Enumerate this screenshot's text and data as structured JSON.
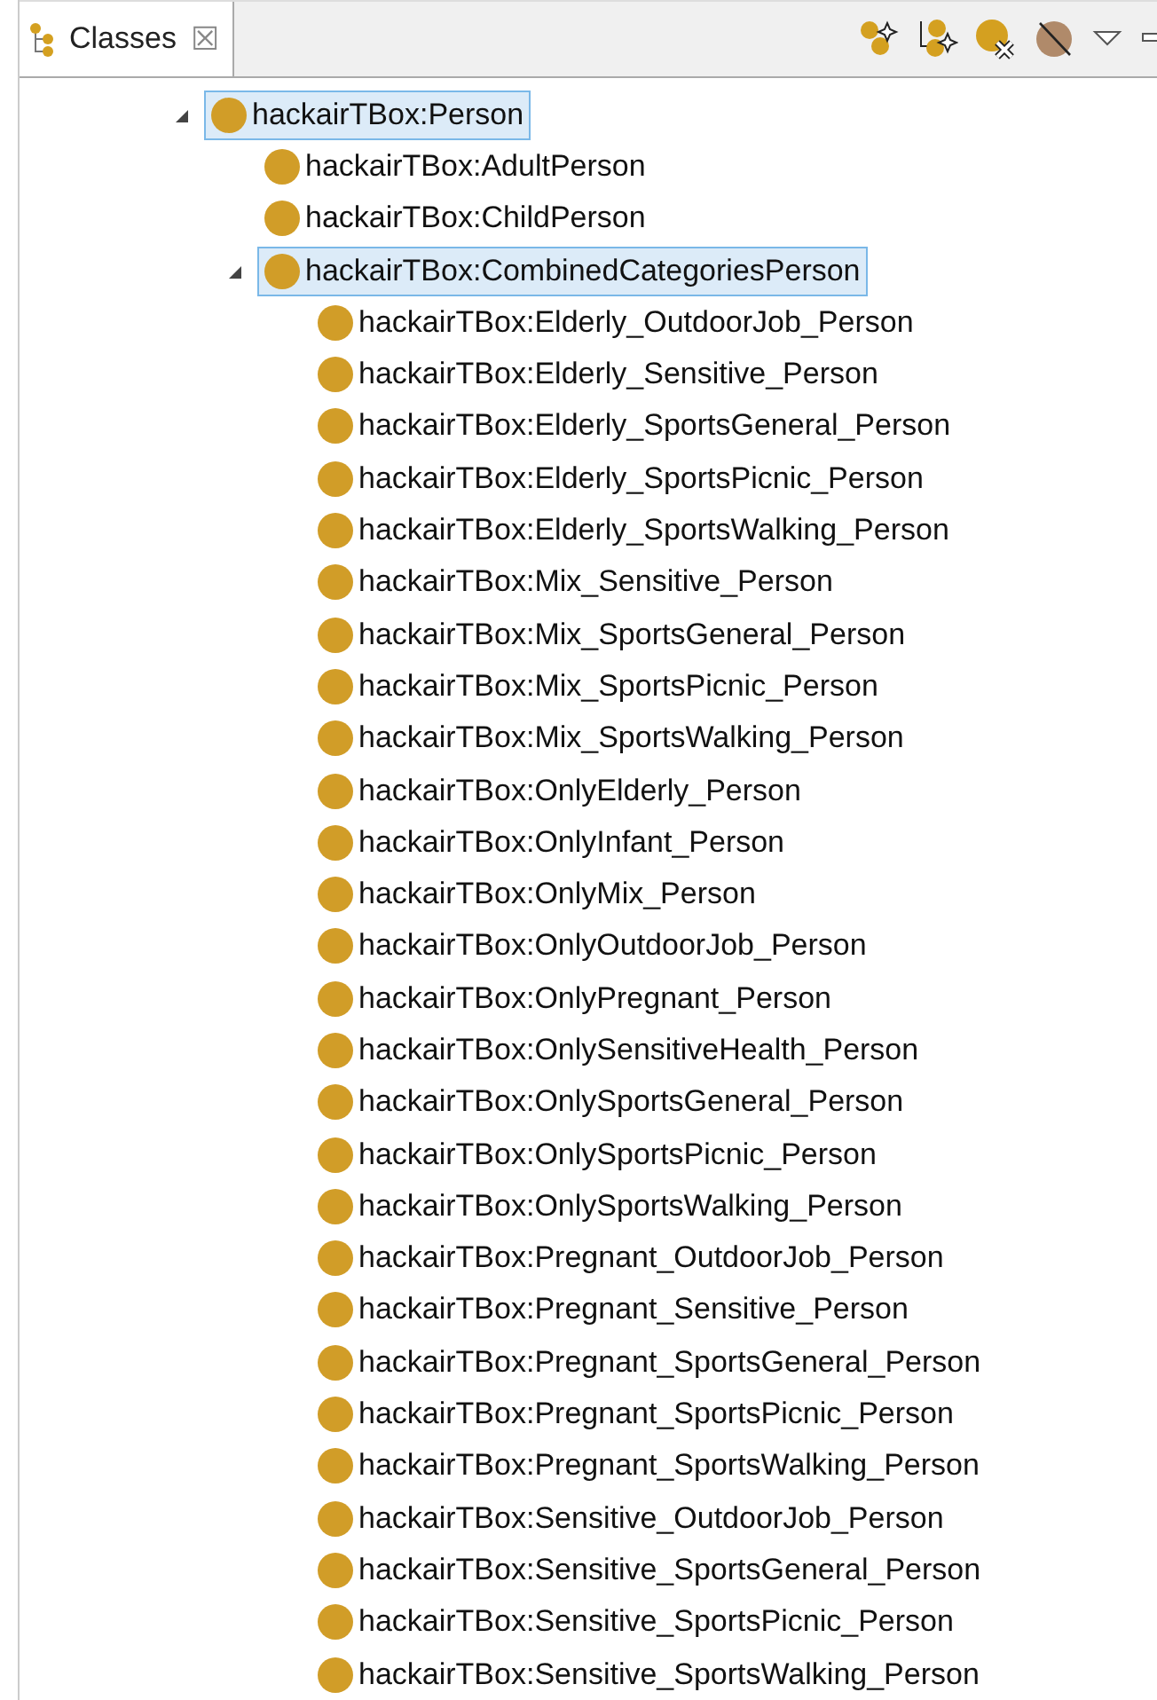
{
  "tab": {
    "title": "Classes",
    "close": "☒"
  },
  "tree": [
    {
      "label": "hackairTBox:Person",
      "expanded": true,
      "selected": true,
      "children": [
        {
          "label": "hackairTBox:AdultPerson",
          "selected": false
        },
        {
          "label": "hackairTBox:ChildPerson",
          "selected": false
        },
        {
          "label": "hackairTBox:CombinedCategoriesPerson",
          "expanded": true,
          "selected": true,
          "children": [
            {
              "label": "hackairTBox:Elderly_OutdoorJob_Person",
              "selected": false
            },
            {
              "label": "hackairTBox:Elderly_Sensitive_Person",
              "selected": false
            },
            {
              "label": "hackairTBox:Elderly_SportsGeneral_Person",
              "selected": false
            },
            {
              "label": "hackairTBox:Elderly_SportsPicnic_Person",
              "selected": false
            },
            {
              "label": "hackairTBox:Elderly_SportsWalking_Person",
              "selected": false
            },
            {
              "label": "hackairTBox:Mix_Sensitive_Person",
              "selected": false
            },
            {
              "label": "hackairTBox:Mix_SportsGeneral_Person",
              "selected": false
            },
            {
              "label": "hackairTBox:Mix_SportsPicnic_Person",
              "selected": false
            },
            {
              "label": "hackairTBox:Mix_SportsWalking_Person",
              "selected": false
            },
            {
              "label": "hackairTBox:OnlyElderly_Person",
              "selected": false
            },
            {
              "label": "hackairTBox:OnlyInfant_Person",
              "selected": false
            },
            {
              "label": "hackairTBox:OnlyMix_Person",
              "selected": false
            },
            {
              "label": "hackairTBox:OnlyOutdoorJob_Person",
              "selected": false
            },
            {
              "label": "hackairTBox:OnlyPregnant_Person",
              "selected": false
            },
            {
              "label": "hackairTBox:OnlySensitiveHealth_Person",
              "selected": false
            },
            {
              "label": "hackairTBox:OnlySportsGeneral_Person",
              "selected": false
            },
            {
              "label": "hackairTBox:OnlySportsPicnic_Person",
              "selected": false
            },
            {
              "label": "hackairTBox:OnlySportsWalking_Person",
              "selected": false
            },
            {
              "label": "hackairTBox:Pregnant_OutdoorJob_Person",
              "selected": false
            },
            {
              "label": "hackairTBox:Pregnant_Sensitive_Person",
              "selected": false
            },
            {
              "label": "hackairTBox:Pregnant_SportsGeneral_Person",
              "selected": false
            },
            {
              "label": "hackairTBox:Pregnant_SportsPicnic_Person",
              "selected": false
            },
            {
              "label": "hackairTBox:Pregnant_SportsWalking_Person",
              "selected": false
            },
            {
              "label": "hackairTBox:Sensitive_OutdoorJob_Person",
              "selected": false
            },
            {
              "label": "hackairTBox:Sensitive_SportsGeneral_Person",
              "selected": false
            },
            {
              "label": "hackairTBox:Sensitive_SportsPicnic_Person",
              "selected": false
            },
            {
              "label": "hackairTBox:Sensitive_SportsWalking_Person",
              "selected": false
            }
          ]
        }
      ]
    }
  ]
}
